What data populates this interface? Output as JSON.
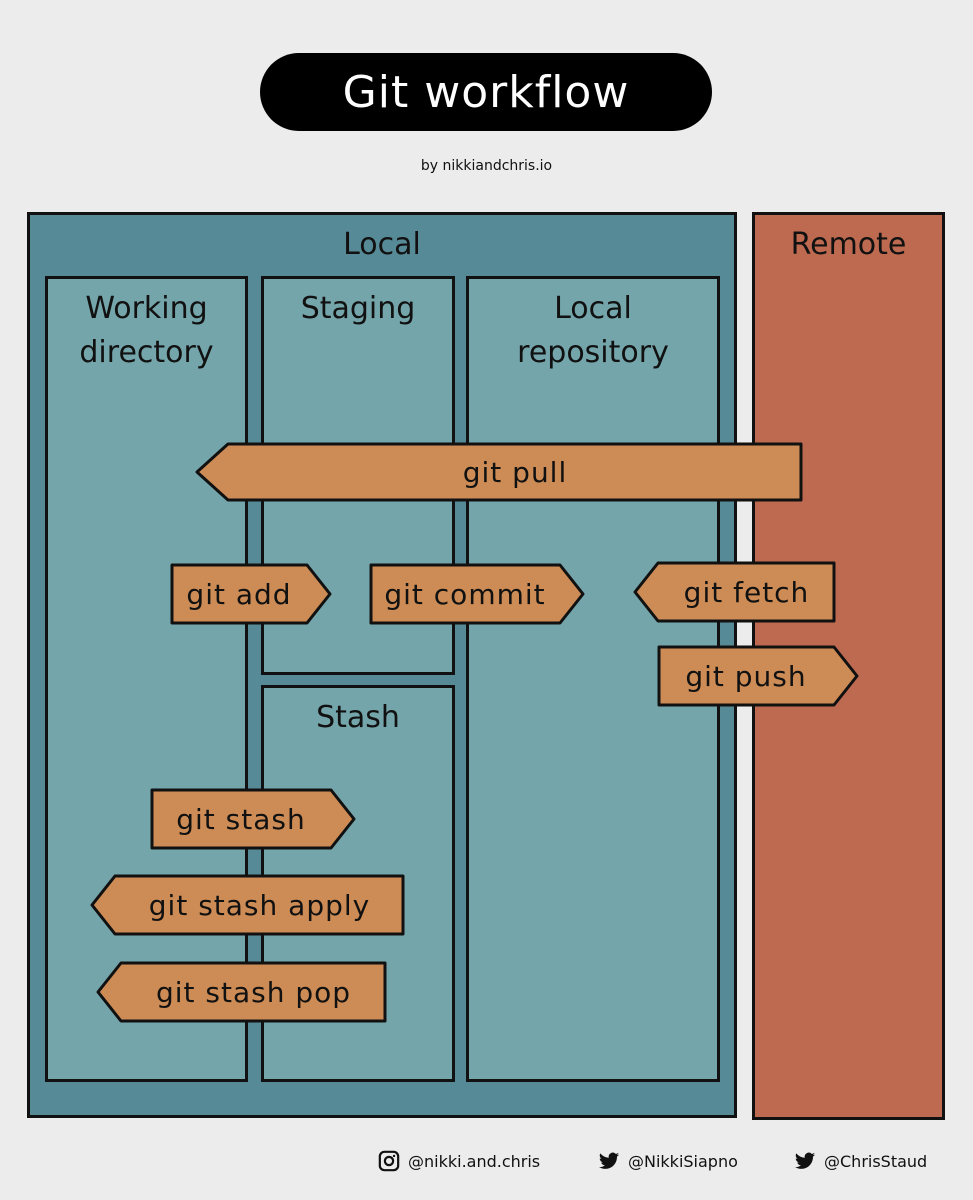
{
  "header": {
    "title": "Git workflow",
    "byline": "by nikkiandchris.io"
  },
  "regions": {
    "local": {
      "label": "Local"
    },
    "remote": {
      "label": "Remote"
    }
  },
  "columns": {
    "working_directory": {
      "line1": "Working",
      "line2": "directory"
    },
    "staging": {
      "label": "Staging"
    },
    "stash": {
      "label": "Stash"
    },
    "local_repository": {
      "line1": "Local",
      "line2": "repository"
    }
  },
  "commands": {
    "pull": {
      "label": "git pull",
      "direction": "left"
    },
    "add": {
      "label": "git add",
      "direction": "right"
    },
    "commit": {
      "label": "git commit",
      "direction": "right"
    },
    "fetch": {
      "label": "git fetch",
      "direction": "left"
    },
    "push": {
      "label": "git push",
      "direction": "right"
    },
    "stash": {
      "label": "git stash",
      "direction": "right"
    },
    "stash_apply": {
      "label": "git stash apply",
      "direction": "left"
    },
    "stash_pop": {
      "label": "git stash pop",
      "direction": "left"
    }
  },
  "colors": {
    "local": "#578a97",
    "column": "#74a5ab",
    "remote": "#bd6a50",
    "arrow": "#cd8c55",
    "background": "#ececec"
  },
  "footer": {
    "instagram": {
      "icon": "instagram-icon",
      "handle": "@nikki.and.chris"
    },
    "twitter1": {
      "icon": "twitter-icon",
      "handle": "@NikkiSiapno"
    },
    "twitter2": {
      "icon": "twitter-icon",
      "handle": "@ChrisStaud"
    }
  }
}
